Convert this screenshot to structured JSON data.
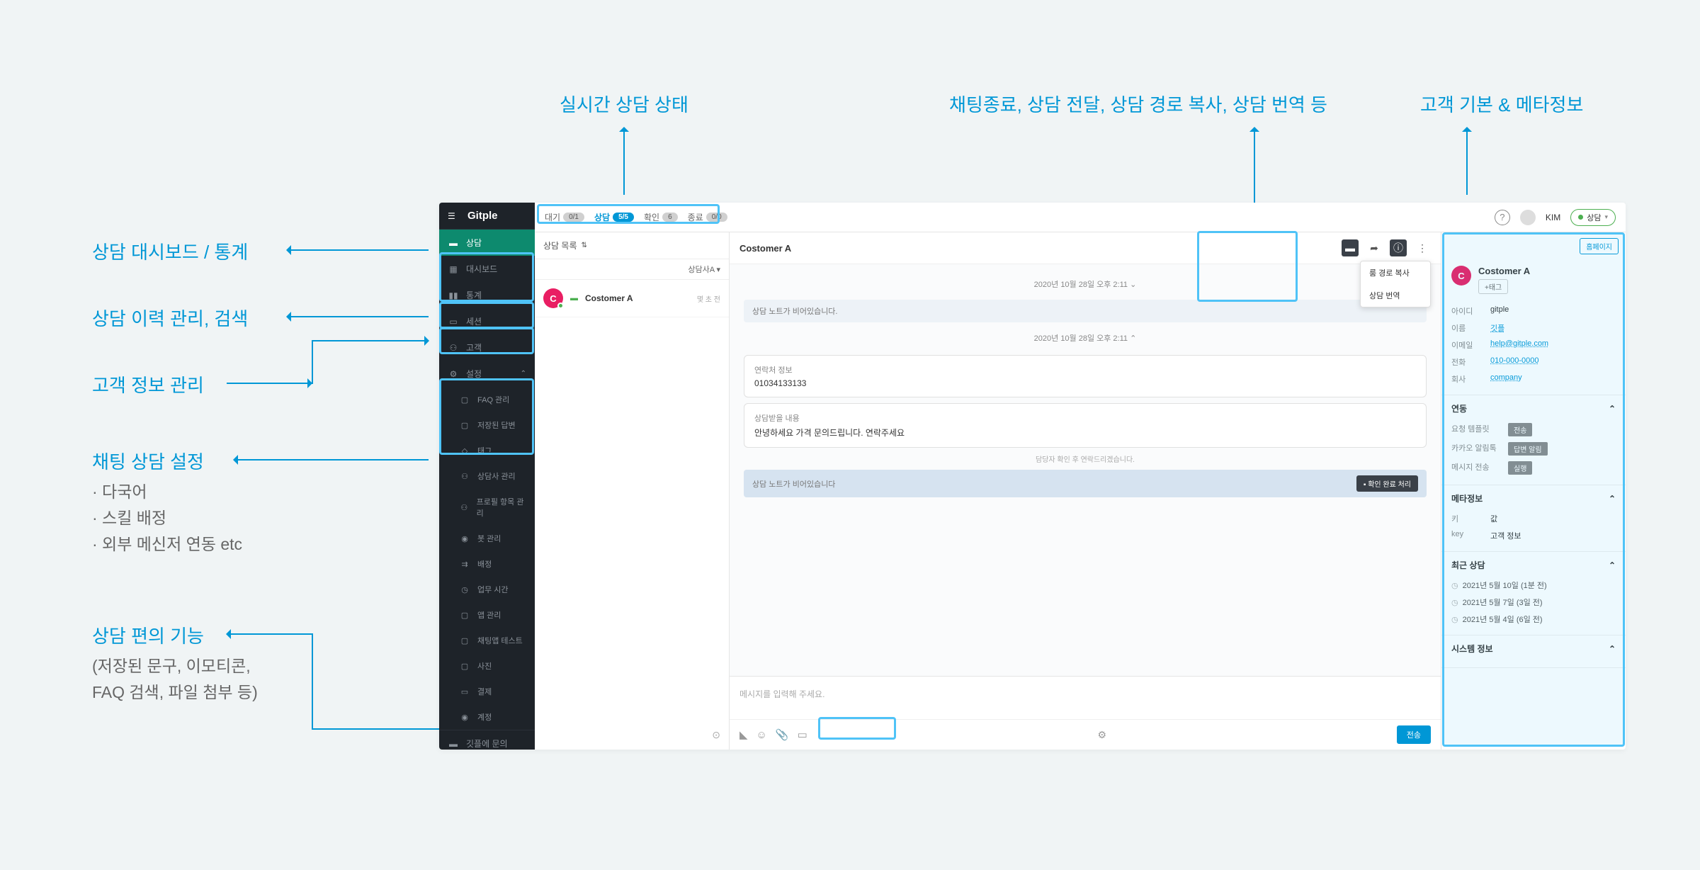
{
  "annotations": {
    "top1": "실시간 상담 상태",
    "top2": "채팅종료, 상담 전달, 상담 경로 복사, 상담 번역 등",
    "top3": "고객 기본 & 메타정보",
    "left1": "상담 대시보드 / 통계",
    "left2": "상담 이력 관리, 검색",
    "left3": "고객 정보 관리",
    "left4": "채팅 상담 설정",
    "left4sub": "· 다국어\n· 스킬 배정\n· 외부 메신저 연동 etc",
    "left5": "상담 편의 기능",
    "left5sub": "(저장된 문구, 이모티콘,\nFAQ 검색, 파일 첨부 등)"
  },
  "logo": "Gitple",
  "nav": {
    "chat": "상담",
    "dashboard": "대시보드",
    "stats": "통계",
    "session": "세션",
    "customer": "고객",
    "settings": "설정",
    "faq": "FAQ 관리",
    "saved": "저장된 답변",
    "tag": "태그",
    "agent_mgmt": "상담사 관리",
    "profile_mgmt": "프로필 항목 관리",
    "bot_mgmt": "봇 관리",
    "assign": "배정",
    "hours": "업무 시간",
    "app_mgmt": "앱 관리",
    "chatapp_test": "채팅앱 테스트",
    "photo": "사진",
    "payment": "결제",
    "account": "계정",
    "contact": "깃플에 문의"
  },
  "header": {
    "tabs": {
      "waiting": {
        "label": "대기",
        "badge": "0/1"
      },
      "chat": {
        "label": "상담",
        "badge": "5/5"
      },
      "confirm": {
        "label": "확인",
        "badge": "6"
      },
      "end": {
        "label": "종료",
        "badge": "0/0"
      }
    },
    "user_name": "KIM",
    "status": "상담"
  },
  "list": {
    "title": "상담 목록",
    "filter": "상담사A ▾",
    "items": [
      {
        "avatar_letter": "C",
        "name": "Costomer A",
        "time": "몇 초 전",
        "tag": ""
      }
    ]
  },
  "chat": {
    "title": "Costomer A",
    "dropdown": {
      "copy_path": "룸 경로 복사",
      "translate": "상담 번역"
    },
    "timestamp1": "2020년 10월 28일 오후 2:11 ⌄",
    "note_empty": "상담 노트가 비어있습니다.",
    "timestamp2": "2020년 10월 28일 오후 2:11 ⌃",
    "msg1_label": "연락처 정보",
    "msg1_text": "01034133133",
    "msg2_label": "상담받을 내용",
    "msg2_text": "안녕하세요 가격 문의드립니다. 연락주세요",
    "sys_msg": "담당자 확인 후 연락드리겠습니다.",
    "note2": "상담 노트가 비어있습니다",
    "note_btn": "확인 완료 처리",
    "placeholder": "메시지를 입력해 주세요.",
    "send": "전송"
  },
  "detail": {
    "home_btn": "홈페이지",
    "name": "Costomer A",
    "tag_btn": "+태그",
    "fields": {
      "id_key": "아이디",
      "id_val": "gitple",
      "name_key": "이름",
      "name_val": "깃플",
      "email_key": "이메일",
      "email_val": "help@gitple.com",
      "phone_key": "전화",
      "phone_val": "010-000-0000",
      "company_key": "회사",
      "company_val": "company"
    },
    "section_link": {
      "title": "연동",
      "row1_key": "요청 템플릿",
      "row1_btn": "전송",
      "row2_key": "카카오 알림톡",
      "row2_btn": "답변 알림",
      "row3_key": "메시지 전송",
      "row3_btn": "실행"
    },
    "section_meta": {
      "title": "메타정보",
      "row1_key": "키",
      "row1_val": "값",
      "row2_key": "key",
      "row2_val": "고객 정보"
    },
    "section_recent": {
      "title": "최근 상담",
      "items": [
        "2021년 5월 10일 (1분 전)",
        "2021년 5월 7일 (3일 전)",
        "2021년 5월 4일 (6일 전)"
      ]
    },
    "section_system": {
      "title": "시스템 정보"
    }
  }
}
